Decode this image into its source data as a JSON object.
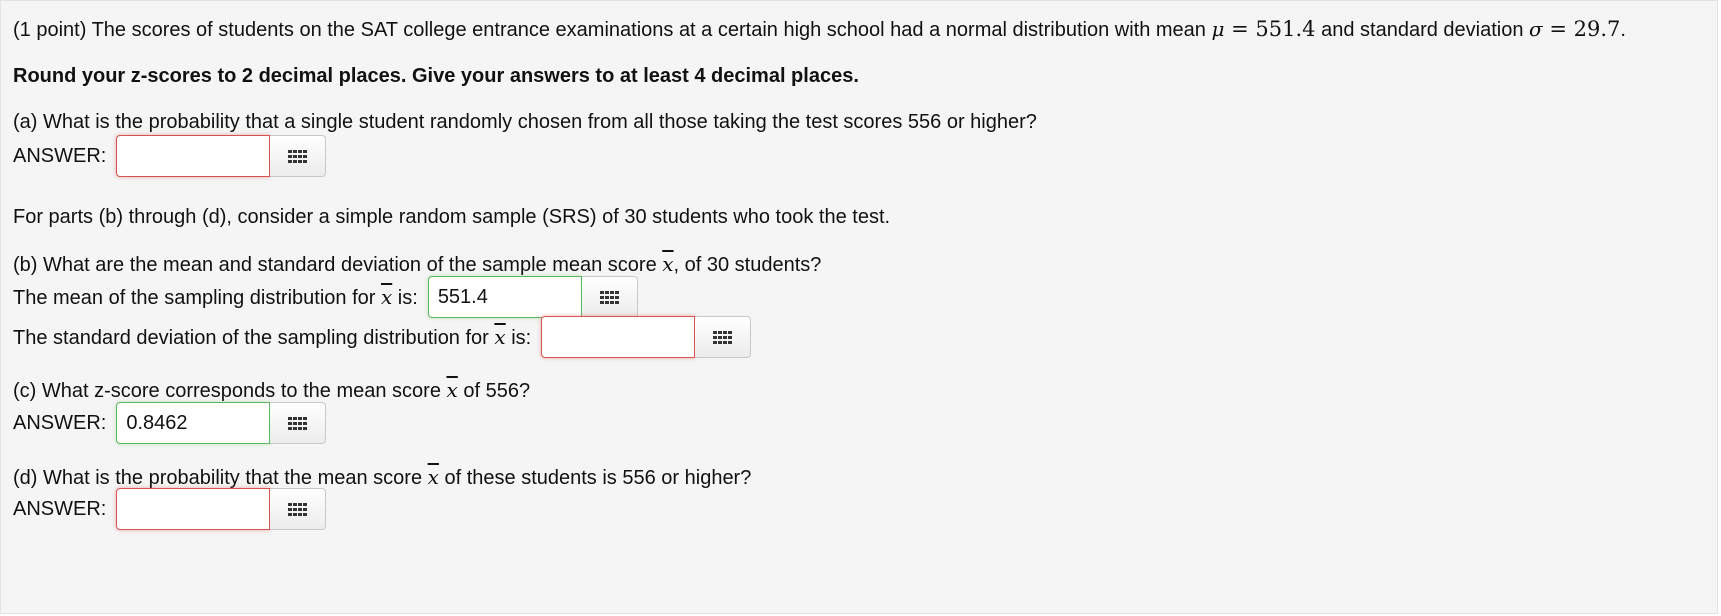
{
  "intro": {
    "text_before_mu": "(1 point) The scores of students on the SAT college entrance examinations at a certain high school had a normal distribution with mean ",
    "mu_symbol": "μ",
    "eq1": " = ",
    "mu_value": "551.4",
    "text_mid": " and standard deviation ",
    "sigma_symbol": "σ",
    "eq2": " = ",
    "sigma_value": "29.7",
    "period": "."
  },
  "instructions": "Round your z-scores to 2 decimal places. Give your answers to at least 4 decimal places.",
  "part_a": {
    "question": "(a) What is the probability that a single student randomly chosen from all those taking the test scores 556 or higher?",
    "label": "ANSWER:",
    "value": ""
  },
  "srs_note": "For parts (b) through (d), consider a simple random sample (SRS) of 30 students who took the test.",
  "part_b": {
    "question_before": "(b) What are the mean and standard deviation of the sample mean score ",
    "xbar": "x",
    "question_after": ", of 30 students?",
    "mean_label_before": "The mean of the sampling distribution for ",
    "mean_label_after": " is:",
    "mean_value": "551.4",
    "sd_label_before": "The standard deviation of the sampling distribution for ",
    "sd_label_after": " is:",
    "sd_value": ""
  },
  "part_c": {
    "question_before": "(c) What z-score corresponds to the mean score ",
    "question_after": " of 556?",
    "label": "ANSWER:",
    "value": "0.8462"
  },
  "part_d": {
    "question_before": "(d) What is the probability that the mean score ",
    "question_after": " of these students is 556 or higher?",
    "label": "ANSWER:",
    "value": ""
  },
  "icons": {
    "equation_editor": "equation-grid-icon"
  },
  "colors": {
    "error_border": "#d9534f",
    "correct_border": "#5cb85c",
    "panel_bg": "#f5f5f5"
  }
}
